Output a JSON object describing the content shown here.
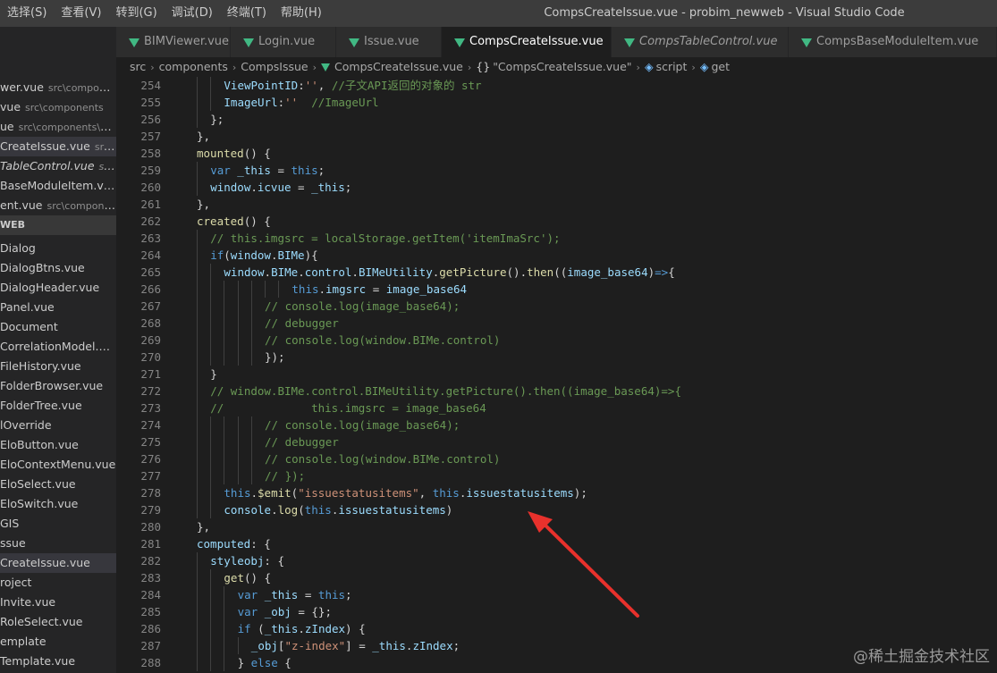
{
  "menu": [
    "选择(S)",
    "查看(V)",
    "转到(G)",
    "调试(D)",
    "终端(T)",
    "帮助(H)"
  ],
  "window_title": "CompsCreateIssue.vue - probim_newweb - Visual Studio Code",
  "tabs": [
    {
      "label": "BIMViewer.vue",
      "active": false,
      "italic": false
    },
    {
      "label": "Login.vue",
      "active": false,
      "italic": false
    },
    {
      "label": "Issue.vue",
      "active": false,
      "italic": false
    },
    {
      "label": "CompsCreateIssue.vue",
      "active": true,
      "italic": false
    },
    {
      "label": "CompsTableControl.vue",
      "active": false,
      "italic": true
    },
    {
      "label": "CompsBaseModuleItem.vue",
      "active": false,
      "italic": false
    }
  ],
  "breadcrumb": {
    "parts": [
      "src",
      "components",
      "CompsIssue"
    ],
    "file": "CompsCreateIssue.vue",
    "component": "\"CompsCreateIssue.vue\"",
    "script": "script",
    "symbol": "get"
  },
  "sidebar": {
    "open_editors": [
      {
        "name": "wer.vue",
        "desc": "src\\compone..."
      },
      {
        "name": "vue",
        "desc": "src\\components"
      },
      {
        "name": "ue",
        "desc": "src\\components\\H..."
      },
      {
        "name": "CreateIssue.vue",
        "desc": "src\\c...",
        "selected": true
      },
      {
        "name": "TableControl.vue",
        "desc": "src\\...",
        "italic": true
      },
      {
        "name": "BaseModuleItem.vue...",
        "desc": ""
      },
      {
        "name": "ent.vue",
        "desc": "src\\compone..."
      }
    ],
    "section_header": "WEB",
    "files": [
      "Dialog",
      "DialogBtns.vue",
      "DialogHeader.vue",
      "Panel.vue",
      "Document",
      "CorrelationModel.vue",
      "FileHistory.vue",
      "FolderBrowser.vue",
      "FolderTree.vue",
      "lOverride",
      "EloButton.vue",
      "EloContextMenu.vue",
      "EloSelect.vue",
      "EloSwitch.vue",
      "GIS",
      "ssue",
      "CreateIssue.vue",
      "roject",
      "Invite.vue",
      "RoleSelect.vue",
      "emplate",
      "Template.vue"
    ],
    "selected_file": "CreateIssue.vue"
  },
  "code_lines": [
    {
      "n": "254",
      "indent": 4,
      "tokens": [
        [
          "p",
          "ViewPointID"
        ],
        [
          "d",
          ":"
        ],
        [
          "s",
          "''"
        ],
        [
          "d",
          ", "
        ],
        [
          "c",
          "//子文API返回的对象的 str"
        ]
      ]
    },
    {
      "n": "255",
      "indent": 4,
      "tokens": [
        [
          "p",
          "ImageUrl"
        ],
        [
          "d",
          ":"
        ],
        [
          "s",
          "''"
        ],
        [
          "d",
          "  "
        ],
        [
          "c",
          "//ImageUrl"
        ]
      ]
    },
    {
      "n": "256",
      "indent": 3,
      "tokens": [
        [
          "d",
          "};"
        ]
      ]
    },
    {
      "n": "257",
      "indent": 2,
      "tokens": [
        [
          "d",
          "},"
        ]
      ]
    },
    {
      "n": "258",
      "indent": 2,
      "tokens": [
        [
          "f",
          "mounted"
        ],
        [
          "d",
          "() {"
        ]
      ]
    },
    {
      "n": "259",
      "indent": 3,
      "tokens": [
        [
          "k",
          "var"
        ],
        [
          "d",
          " "
        ],
        [
          "p",
          "_this"
        ],
        [
          "d",
          " = "
        ],
        [
          "k",
          "this"
        ],
        [
          "d",
          ";"
        ]
      ]
    },
    {
      "n": "260",
      "indent": 3,
      "tokens": [
        [
          "p",
          "window"
        ],
        [
          "d",
          "."
        ],
        [
          "p",
          "icvue"
        ],
        [
          "d",
          " = "
        ],
        [
          "p",
          "_this"
        ],
        [
          "d",
          ";"
        ]
      ]
    },
    {
      "n": "261",
      "indent": 2,
      "tokens": [
        [
          "d",
          "},"
        ]
      ]
    },
    {
      "n": "262",
      "indent": 2,
      "tokens": [
        [
          "f",
          "created"
        ],
        [
          "d",
          "() {"
        ]
      ]
    },
    {
      "n": "263",
      "indent": 3,
      "tokens": [
        [
          "c",
          "// this.imgsrc = localStorage.getItem('itemImaSrc');"
        ]
      ]
    },
    {
      "n": "264",
      "indent": 3,
      "tokens": [
        [
          "k",
          "if"
        ],
        [
          "d",
          "("
        ],
        [
          "p",
          "window"
        ],
        [
          "d",
          "."
        ],
        [
          "p",
          "BIMe"
        ],
        [
          "d",
          "){"
        ]
      ]
    },
    {
      "n": "265",
      "indent": 4,
      "tokens": [
        [
          "p",
          "window"
        ],
        [
          "d",
          "."
        ],
        [
          "p",
          "BIMe"
        ],
        [
          "d",
          "."
        ],
        [
          "p",
          "control"
        ],
        [
          "d",
          "."
        ],
        [
          "p",
          "BIMeUtility"
        ],
        [
          "d",
          "."
        ],
        [
          "f",
          "getPicture"
        ],
        [
          "d",
          "()."
        ],
        [
          "f",
          "then"
        ],
        [
          "d",
          "(("
        ],
        [
          "p",
          "image_base64"
        ],
        [
          "d",
          ")"
        ],
        [
          "k",
          "=>"
        ],
        [
          "d",
          "{"
        ]
      ]
    },
    {
      "n": "266",
      "indent": 9,
      "tokens": [
        [
          "k",
          "this"
        ],
        [
          "d",
          "."
        ],
        [
          "p",
          "imgsrc"
        ],
        [
          "d",
          " = "
        ],
        [
          "p",
          "image_base64"
        ]
      ]
    },
    {
      "n": "267",
      "indent": 7,
      "tokens": [
        [
          "c",
          "// console.log(image_base64);"
        ]
      ]
    },
    {
      "n": "268",
      "indent": 7,
      "tokens": [
        [
          "c",
          "// debugger"
        ]
      ]
    },
    {
      "n": "269",
      "indent": 7,
      "tokens": [
        [
          "c",
          "// console.log(window.BIMe.control)"
        ]
      ]
    },
    {
      "n": "270",
      "indent": 7,
      "tokens": [
        [
          "d",
          "});"
        ]
      ]
    },
    {
      "n": "271",
      "indent": 3,
      "tokens": [
        [
          "d",
          "}"
        ]
      ]
    },
    {
      "n": "272",
      "indent": 3,
      "tokens": [
        [
          "c",
          "// window.BIMe.control.BIMeUtility.getPicture().then((image_base64)=>{"
        ]
      ]
    },
    {
      "n": "273",
      "indent": 3,
      "tokens": [
        [
          "c",
          "//             this.imgsrc = image_base64"
        ]
      ]
    },
    {
      "n": "274",
      "indent": 7,
      "tokens": [
        [
          "c",
          "// console.log(image_base64);"
        ]
      ]
    },
    {
      "n": "275",
      "indent": 7,
      "tokens": [
        [
          "c",
          "// debugger"
        ]
      ]
    },
    {
      "n": "276",
      "indent": 7,
      "tokens": [
        [
          "c",
          "// console.log(window.BIMe.control)"
        ]
      ]
    },
    {
      "n": "277",
      "indent": 7,
      "tokens": [
        [
          "c",
          "// });"
        ]
      ]
    },
    {
      "n": "278",
      "indent": 4,
      "tokens": [
        [
          "k",
          "this"
        ],
        [
          "d",
          "."
        ],
        [
          "f",
          "$emit"
        ],
        [
          "d",
          "("
        ],
        [
          "s",
          "\"issuestatusitems\""
        ],
        [
          "d",
          ", "
        ],
        [
          "k",
          "this"
        ],
        [
          "d",
          "."
        ],
        [
          "p",
          "issuestatusitems"
        ],
        [
          "d",
          ");"
        ]
      ]
    },
    {
      "n": "279",
      "indent": 4,
      "tokens": [
        [
          "p",
          "console"
        ],
        [
          "d",
          "."
        ],
        [
          "f",
          "log"
        ],
        [
          "d",
          "("
        ],
        [
          "k",
          "this"
        ],
        [
          "d",
          "."
        ],
        [
          "p",
          "issuestatusitems"
        ],
        [
          "d",
          ")"
        ]
      ]
    },
    {
      "n": "280",
      "indent": 2,
      "tokens": [
        [
          "d",
          "},"
        ]
      ]
    },
    {
      "n": "281",
      "indent": 2,
      "tokens": [
        [
          "p",
          "computed"
        ],
        [
          "d",
          ": {"
        ]
      ]
    },
    {
      "n": "282",
      "indent": 3,
      "tokens": [
        [
          "p",
          "styleobj"
        ],
        [
          "d",
          ": {"
        ]
      ]
    },
    {
      "n": "283",
      "indent": 4,
      "tokens": [
        [
          "f",
          "get"
        ],
        [
          "d",
          "() {"
        ]
      ]
    },
    {
      "n": "284",
      "indent": 5,
      "tokens": [
        [
          "k",
          "var"
        ],
        [
          "d",
          " "
        ],
        [
          "p",
          "_this"
        ],
        [
          "d",
          " = "
        ],
        [
          "k",
          "this"
        ],
        [
          "d",
          ";"
        ]
      ]
    },
    {
      "n": "285",
      "indent": 5,
      "tokens": [
        [
          "k",
          "var"
        ],
        [
          "d",
          " "
        ],
        [
          "p",
          "_obj"
        ],
        [
          "d",
          " = {};"
        ]
      ]
    },
    {
      "n": "286",
      "indent": 5,
      "tokens": [
        [
          "k",
          "if"
        ],
        [
          "d",
          " ("
        ],
        [
          "p",
          "_this"
        ],
        [
          "d",
          "."
        ],
        [
          "p",
          "zIndex"
        ],
        [
          "d",
          ") {"
        ]
      ]
    },
    {
      "n": "287",
      "indent": 6,
      "tokens": [
        [
          "p",
          "_obj"
        ],
        [
          "d",
          "["
        ],
        [
          "s",
          "\"z-index\""
        ],
        [
          "d",
          "] = "
        ],
        [
          "p",
          "_this"
        ],
        [
          "d",
          "."
        ],
        [
          "p",
          "zIndex"
        ],
        [
          "d",
          ";"
        ]
      ]
    },
    {
      "n": "288",
      "indent": 5,
      "tokens": [
        [
          "d",
          "} "
        ],
        [
          "k",
          "else"
        ],
        [
          "d",
          " {"
        ]
      ]
    }
  ],
  "annotation_arrow_color": "#e8312c",
  "watermark": "@稀土掘金技术社区"
}
